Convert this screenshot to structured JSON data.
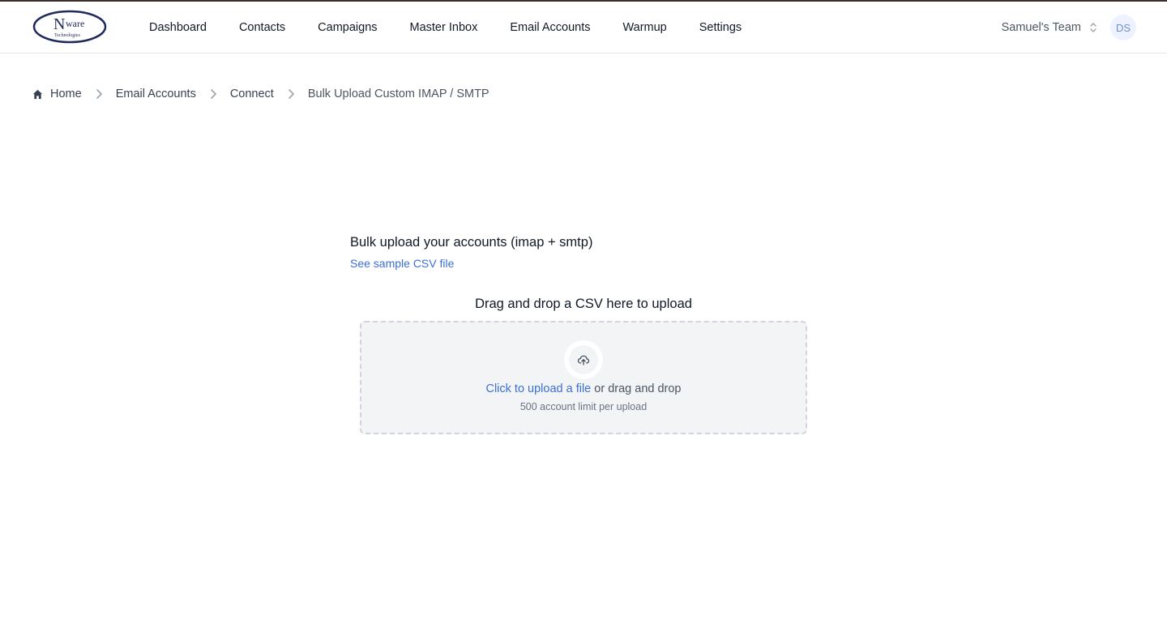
{
  "brand": {
    "logo_main": "N",
    "logo_sup": "ware",
    "logo_sub": "Technologies"
  },
  "nav": {
    "items": [
      {
        "label": "Dashboard"
      },
      {
        "label": "Contacts"
      },
      {
        "label": "Campaigns"
      },
      {
        "label": "Master Inbox"
      },
      {
        "label": "Email Accounts"
      },
      {
        "label": "Warmup"
      },
      {
        "label": "Settings"
      }
    ],
    "team_label": "Samuel's Team",
    "team_icon": "chevron-up-down-icon",
    "avatar_initials": "DS"
  },
  "breadcrumb": {
    "home_icon": "home-icon",
    "separator_icon": "chevron-right-icon",
    "items": [
      {
        "label": "Home"
      },
      {
        "label": "Email Accounts"
      },
      {
        "label": "Connect"
      },
      {
        "label": "Bulk Upload Custom IMAP / SMTP"
      }
    ]
  },
  "main": {
    "heading": "Bulk upload your accounts (imap + smtp)",
    "sample_link": "See sample CSV file",
    "drop_title": "Drag and drop a CSV here to upload",
    "upload_icon": "cloud-upload-icon",
    "click_label": "Click to upload a file",
    "drag_label": " or drag and drop",
    "limit_text": "500 account limit per upload"
  },
  "colors": {
    "accent": "#3b6fd4",
    "dropzone_bg": "#f3f4f6",
    "dropzone_border": "#d1d5db",
    "logo_navy": "#1f2a5a"
  }
}
